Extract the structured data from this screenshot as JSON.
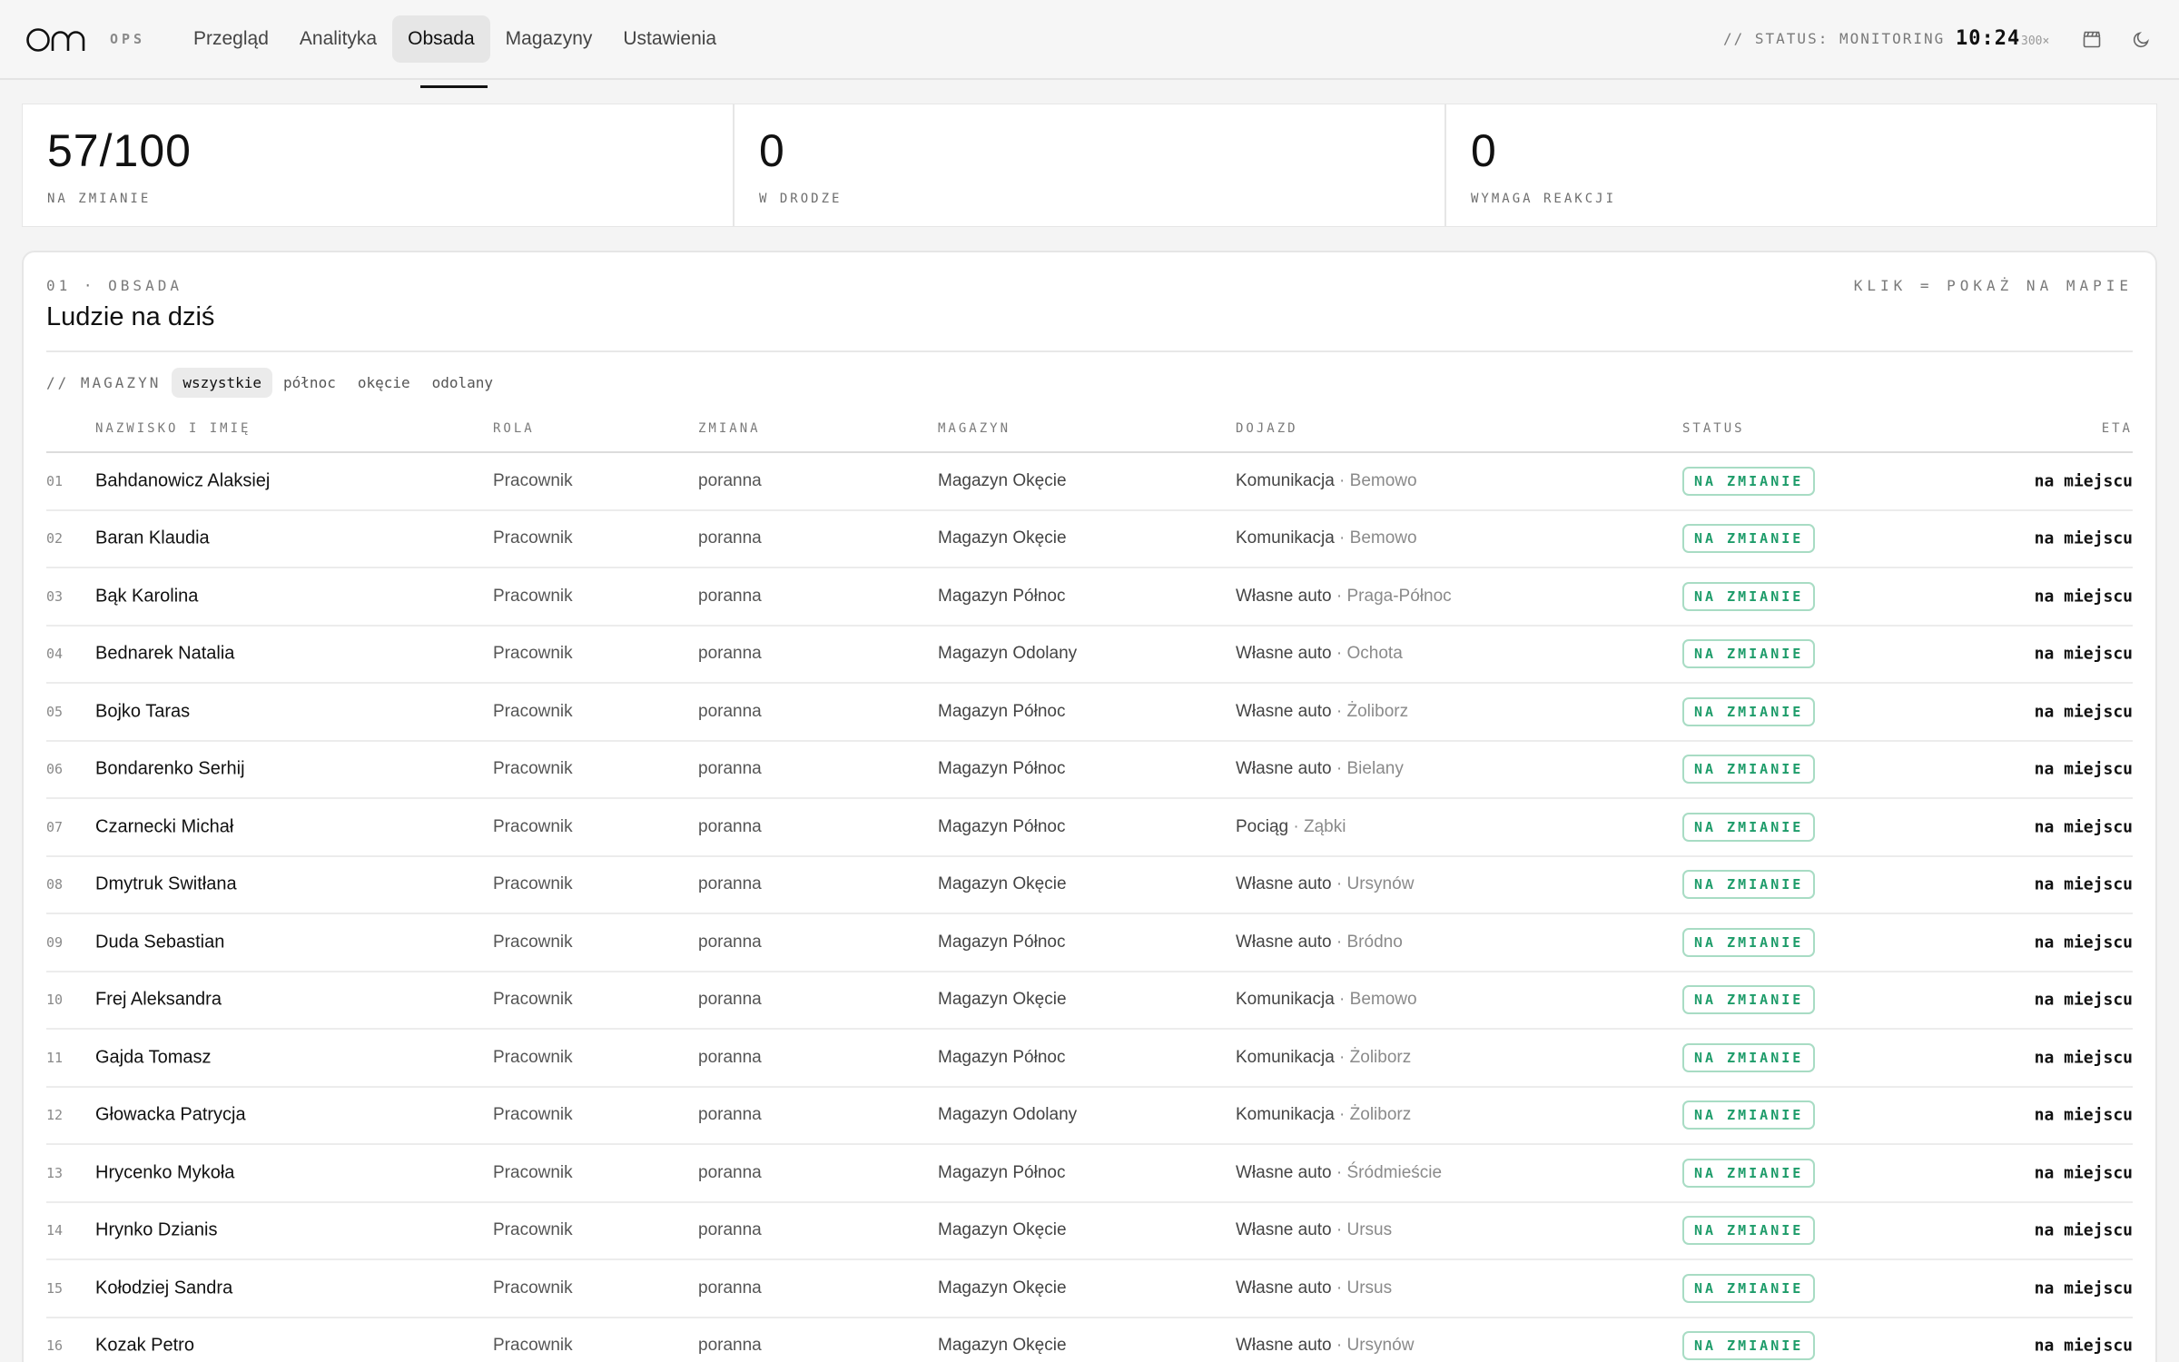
{
  "app": {
    "logo_text": "om",
    "logo_sub": "OPS"
  },
  "nav": {
    "items": [
      {
        "label": "Przegląd",
        "active": false
      },
      {
        "label": "Analityka",
        "active": false
      },
      {
        "label": "Obsada",
        "active": true
      },
      {
        "label": "Magazyny",
        "active": false
      },
      {
        "label": "Ustawienia",
        "active": false
      }
    ]
  },
  "header": {
    "status": "// STATUS: MONITORING",
    "time": "10:24",
    "speed": "300×"
  },
  "stats": [
    {
      "value": "57/100",
      "label": "NA ZMIANIE"
    },
    {
      "value": "0",
      "label": "W DRODZE"
    },
    {
      "value": "0",
      "label": "WYMAGA REAKCJI"
    }
  ],
  "section": {
    "kicker": "01 · OBSADA",
    "title": "Ludzie na dziś",
    "hint": "KLIK = POKAŻ NA MAPIE"
  },
  "filters": {
    "label": "// MAGAZYN",
    "options": [
      {
        "label": "wszystkie",
        "active": true
      },
      {
        "label": "północ",
        "active": false
      },
      {
        "label": "okęcie",
        "active": false
      },
      {
        "label": "odolany",
        "active": false
      }
    ]
  },
  "table": {
    "columns": [
      "NAZWISKO I IMIĘ",
      "ROLA",
      "ZMIANA",
      "MAGAZYN",
      "DOJAZD",
      "STATUS",
      "ETA"
    ],
    "rows": [
      {
        "idx": "01",
        "name": "Bahdanowicz Alaksiej",
        "role": "Pracownik",
        "shift": "poranna",
        "warehouse": "Magazyn Okęcie",
        "transport": "Komunikacja",
        "area": " · Bemowo",
        "status": "NA ZMIANIE",
        "eta": "na miejscu"
      },
      {
        "idx": "02",
        "name": "Baran Klaudia",
        "role": "Pracownik",
        "shift": "poranna",
        "warehouse": "Magazyn Okęcie",
        "transport": "Komunikacja",
        "area": " · Bemowo",
        "status": "NA ZMIANIE",
        "eta": "na miejscu"
      },
      {
        "idx": "03",
        "name": "Bąk Karolina",
        "role": "Pracownik",
        "shift": "poranna",
        "warehouse": "Magazyn Północ",
        "transport": "Własne auto",
        "area": " · Praga-Północ",
        "status": "NA ZMIANIE",
        "eta": "na miejscu"
      },
      {
        "idx": "04",
        "name": "Bednarek Natalia",
        "role": "Pracownik",
        "shift": "poranna",
        "warehouse": "Magazyn Odolany",
        "transport": "Własne auto",
        "area": " · Ochota",
        "status": "NA ZMIANIE",
        "eta": "na miejscu"
      },
      {
        "idx": "05",
        "name": "Bojko Taras",
        "role": "Pracownik",
        "shift": "poranna",
        "warehouse": "Magazyn Północ",
        "transport": "Własne auto",
        "area": " · Żoliborz",
        "status": "NA ZMIANIE",
        "eta": "na miejscu"
      },
      {
        "idx": "06",
        "name": "Bondarenko Serhij",
        "role": "Pracownik",
        "shift": "poranna",
        "warehouse": "Magazyn Północ",
        "transport": "Własne auto",
        "area": " · Bielany",
        "status": "NA ZMIANIE",
        "eta": "na miejscu"
      },
      {
        "idx": "07",
        "name": "Czarnecki Michał",
        "role": "Pracownik",
        "shift": "poranna",
        "warehouse": "Magazyn Północ",
        "transport": "Pociąg",
        "area": " · Ząbki",
        "status": "NA ZMIANIE",
        "eta": "na miejscu"
      },
      {
        "idx": "08",
        "name": "Dmytruk Switłana",
        "role": "Pracownik",
        "shift": "poranna",
        "warehouse": "Magazyn Okęcie",
        "transport": "Własne auto",
        "area": " · Ursynów",
        "status": "NA ZMIANIE",
        "eta": "na miejscu"
      },
      {
        "idx": "09",
        "name": "Duda Sebastian",
        "role": "Pracownik",
        "shift": "poranna",
        "warehouse": "Magazyn Północ",
        "transport": "Własne auto",
        "area": " · Bródno",
        "status": "NA ZMIANIE",
        "eta": "na miejscu"
      },
      {
        "idx": "10",
        "name": "Frej Aleksandra",
        "role": "Pracownik",
        "shift": "poranna",
        "warehouse": "Magazyn Okęcie",
        "transport": "Komunikacja",
        "area": " · Bemowo",
        "status": "NA ZMIANIE",
        "eta": "na miejscu"
      },
      {
        "idx": "11",
        "name": "Gajda Tomasz",
        "role": "Pracownik",
        "shift": "poranna",
        "warehouse": "Magazyn Północ",
        "transport": "Komunikacja",
        "area": " · Żoliborz",
        "status": "NA ZMIANIE",
        "eta": "na miejscu"
      },
      {
        "idx": "12",
        "name": "Głowacka Patrycja",
        "role": "Pracownik",
        "shift": "poranna",
        "warehouse": "Magazyn Odolany",
        "transport": "Komunikacja",
        "area": " · Żoliborz",
        "status": "NA ZMIANIE",
        "eta": "na miejscu"
      },
      {
        "idx": "13",
        "name": "Hrycenko Mykoła",
        "role": "Pracownik",
        "shift": "poranna",
        "warehouse": "Magazyn Północ",
        "transport": "Własne auto",
        "area": " · Śródmieście",
        "status": "NA ZMIANIE",
        "eta": "na miejscu"
      },
      {
        "idx": "14",
        "name": "Hrynko Dzianis",
        "role": "Pracownik",
        "shift": "poranna",
        "warehouse": "Magazyn Okęcie",
        "transport": "Własne auto",
        "area": " · Ursus",
        "status": "NA ZMIANIE",
        "eta": "na miejscu"
      },
      {
        "idx": "15",
        "name": "Kołodziej Sandra",
        "role": "Pracownik",
        "shift": "poranna",
        "warehouse": "Magazyn Okęcie",
        "transport": "Własne auto",
        "area": " · Ursus",
        "status": "NA ZMIANIE",
        "eta": "na miejscu"
      },
      {
        "idx": "16",
        "name": "Kozak Petro",
        "role": "Pracownik",
        "shift": "poranna",
        "warehouse": "Magazyn Okęcie",
        "transport": "Własne auto",
        "area": " · Ursynów",
        "status": "NA ZMIANIE",
        "eta": "na miejscu"
      }
    ]
  },
  "colors": {
    "accent_green": "#1e9c6a",
    "badge_border": "#a8dcc4"
  },
  "icons": {
    "clapper": "clapperboard-icon",
    "theme": "moon-icon"
  }
}
